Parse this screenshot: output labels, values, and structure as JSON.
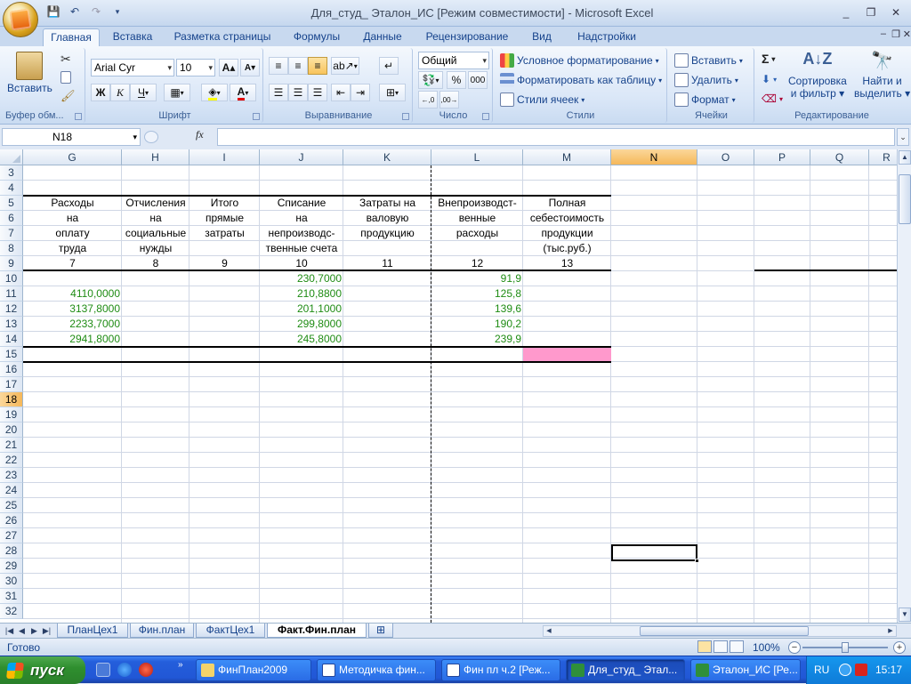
{
  "window": {
    "title": "Для_студ_ Эталон_ИС  [Режим совместимости] - Microsoft Excel",
    "controls": [
      "_",
      "❐",
      "✕"
    ]
  },
  "ribbon": {
    "tabs": [
      "Главная",
      "Вставка",
      "Разметка страницы",
      "Формулы",
      "Данные",
      "Рецензирование",
      "Вид",
      "Надстройки"
    ],
    "active_tab": "Главная",
    "groups": {
      "clipboard": {
        "label": "Буфер обм...",
        "paste": "Вставить"
      },
      "font": {
        "label": "Шрифт",
        "font_name": "Arial Cyr",
        "font_size": "10",
        "bold": "Ж",
        "italic": "К",
        "underline": "Ч"
      },
      "alignment": {
        "label": "Выравнивание"
      },
      "number": {
        "label": "Число",
        "format": "Общий",
        "percent": "%",
        "thousands": "000"
      },
      "styles": {
        "label": "Стили",
        "conditional": "Условное форматирование",
        "as_table": "Форматировать как таблицу",
        "cell_styles": "Стили ячеек"
      },
      "cells": {
        "label": "Ячейки",
        "insert": "Вставить",
        "delete": "Удалить",
        "format": "Формат"
      },
      "editing": {
        "label": "Редактирование",
        "sort_l1": "Сортировка",
        "sort_l2": "и фильтр",
        "find_l1": "Найти и",
        "find_l2": "выделить",
        "sum": "Σ"
      }
    }
  },
  "formula_bar": {
    "name_box": "N18",
    "fx": "fx",
    "formula": ""
  },
  "sheet": {
    "columns": [
      "G",
      "H",
      "I",
      "J",
      "K",
      "L",
      "M",
      "N",
      "O",
      "P",
      "Q",
      "R"
    ],
    "selected_column": "N",
    "rows": [
      "3",
      "4",
      "5",
      "6",
      "7",
      "8",
      "9",
      "10",
      "11",
      "12",
      "13",
      "14",
      "15",
      "16",
      "17",
      "18",
      "19",
      "20",
      "21",
      "22",
      "23",
      "24",
      "25",
      "26",
      "27",
      "28",
      "29",
      "30",
      "31",
      "32"
    ],
    "selected_row": "18",
    "headers": {
      "G": [
        "Расходы",
        "на",
        "оплату",
        "труда"
      ],
      "H": [
        "Отчисления",
        "на",
        "социальные",
        "нужды"
      ],
      "I": [
        "Итого",
        "прямые",
        "затраты"
      ],
      "J": [
        "Списание",
        "на",
        "непроизводс-",
        "твенные счета"
      ],
      "K": [
        "Затраты на",
        "валовую",
        "продукцию"
      ],
      "L": [
        "Внепроизводст-",
        "венные",
        "расходы"
      ],
      "M": [
        "Полная",
        "себестоимость",
        "продукции",
        "(тыс.руб.)"
      ]
    },
    "col_numbers": {
      "G": "7",
      "H": "8",
      "I": "9",
      "J": "10",
      "K": "11",
      "L": "12",
      "M": "13"
    },
    "values": {
      "G": [
        "",
        "4110,0000",
        "3137,8000",
        "2233,7000",
        "2941,8000"
      ],
      "J": [
        "230,7000",
        "210,8800",
        "201,1000",
        "299,8000",
        "245,8000"
      ],
      "L": [
        "91,9",
        "125,8",
        "139,6",
        "190,2",
        "239,9"
      ]
    },
    "highlight_color": "#ff99cc",
    "value_color": "#1f8c14"
  },
  "sheet_tabs": [
    "ПланЦех1",
    "Фин.план",
    "ФактЦех1",
    "Факт.Фин.план"
  ],
  "active_sheet": "Факт.Фин.план",
  "status": {
    "text": "Готово",
    "zoom": "100%"
  },
  "taskbar": {
    "start": "пуск",
    "tasks": [
      "ФинПлан2009",
      "Методичка фин...",
      "Фин пл ч.2 [Реж...",
      "Для_студ_ Этал...",
      "Эталон_ИС [Ре..."
    ],
    "active_task": "Для_студ_ Этал...",
    "language": "RU",
    "clock": "15:17"
  }
}
